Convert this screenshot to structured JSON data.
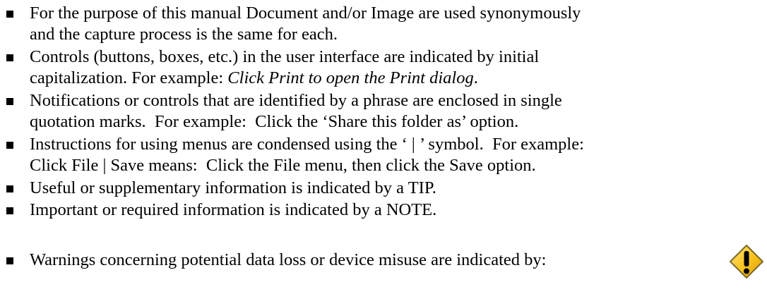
{
  "conventions": {
    "items": [
      {
        "lines": [
          "For the purpose of this manual Document and/or Image are used synonymously",
          "and the capture process is the same for each."
        ]
      },
      {
        "lines": [
          "Controls (buttons, boxes, etc.) in the user interface are indicated by initial",
          "capitalization. For example: "
        ],
        "example": "Click Print to open the Print dialog",
        "example_suffix": "."
      },
      {
        "lines": [
          "Notifications or controls that are identified by a phrase are enclosed in single",
          "quotation marks.  For example:  Click the ‘Share this folder as’ option."
        ]
      },
      {
        "lines": [
          "Instructions for using menus are condensed using the ‘ | ’ symbol.  For example:",
          "Click File | Save means:  Click the File menu, then click the Save option."
        ]
      },
      {
        "lines": [
          "Useful or supplementary information is indicated by a TIP."
        ]
      },
      {
        "lines": [
          "Important or required information is indicated by a NOTE."
        ]
      },
      {
        "lines": [
          "Warnings concerning potential data loss or device misuse are indicated by:"
        ]
      }
    ],
    "warning_icon": {
      "name": "warning-icon",
      "fill": "#f7c21b",
      "stroke": "#7a6a2a",
      "glyph_color": "#000000"
    }
  }
}
